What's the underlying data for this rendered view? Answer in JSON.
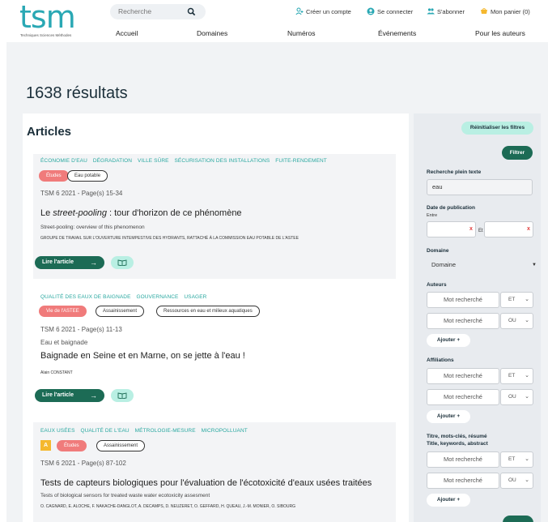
{
  "header": {
    "logo_text": "tsm",
    "logo_sub": "Techniques Sciences Méthodes",
    "search_placeholder": "Recherche",
    "create_account": "Créer un compte",
    "login": "Se connecter",
    "subscribe": "S'abonner",
    "cart": "Mon panier (0)",
    "nav": [
      "Accueil",
      "Domaines",
      "Numéros",
      "Événements",
      "Pour les auteurs"
    ]
  },
  "results": {
    "title": "1638 résultats"
  },
  "articles": {
    "heading": "Articles",
    "items": [
      {
        "tags": [
          "ÉCONOMIE D'EAU",
          "DÉGRADATION",
          "VILLE SÛRE",
          "SÉCURISATION DES INSTALLATIONS",
          "FUITE-RENDEMENT"
        ],
        "pills": [
          "Études",
          "Eau potable"
        ],
        "meta": "TSM 6 2021 - Page(s) 15-34",
        "title_pre": "Le ",
        "title_em": "street-pooling",
        "title_post": " : tour d'horizon de ce phénomène",
        "subtitle": "Street-pooling: overview of this phenomenon",
        "authors": "GROUPE DE TRAVAIL SUR L'OUVERTURE INTEMPESTIVE DES HYDRANTS, RATTACHÉ À LA COMMISSION EAU POTABLE DE L'ASTEE",
        "read_label": "Lire l'article"
      },
      {
        "tags": [
          "QUALITÉ DES EAUX DE BAIGNADE",
          "GOUVERNANCE",
          "USAGER"
        ],
        "pills": [
          "Vie de l'ASTEE",
          "Assainissement",
          "Ressources en eau et milieux aquatiques"
        ],
        "meta": "TSM 6 2021 - Page(s) 11-13",
        "rubric": "Eau et baignade",
        "title": "Baignade en Seine et en Marne, on se jette à l'eau !",
        "authors": "Alain CONSTANT",
        "read_label": "Lire l'article"
      },
      {
        "tags": [
          "EAUX USÉES",
          "QUALITÉ DE L'EAU",
          "MÉTROLOGIE-MESURE",
          "MICROPOLLUANT"
        ],
        "badge": "A",
        "pills": [
          "Études",
          "Assainissement"
        ],
        "meta": "TSM 6 2021 - Page(s) 87-102",
        "title": "Tests de capteurs biologiques pour l'évaluation de l'écotoxicité d'eaux usées traitées",
        "subtitle": "Tests of biological sensors for treated waste water ecotoxicity assesment",
        "authors": "O. CAGNARD, E. ALOCHE, F. NAKACHE-DANGLOT, A. DECAMPS, D. NEUZERET, O. GEFFARD, H. QUEAU, J.-M. MONIER, O. SIBOURG"
      }
    ]
  },
  "sidebar": {
    "reset": "Réinitialiser les filtres",
    "filter": "Filtrer",
    "fulltext_label": "Recherche plein texte",
    "fulltext_value": "eau",
    "date_label": "Date de publication",
    "date_between": "Entre",
    "date_and": "Et",
    "clear_x": "x",
    "domain_label": "Domaine",
    "domain_value": "Domaine",
    "authors_label": "Auteurs",
    "affiliations_label": "Affiliations",
    "keywords_label_fr": "Titre, mots-clés, résumé",
    "keywords_label_en": "Title, keywords, abstract",
    "field_placeholder": "Mot recherché",
    "op_and": "ET",
    "op_or": "OU",
    "add": "Ajouter  +"
  }
}
